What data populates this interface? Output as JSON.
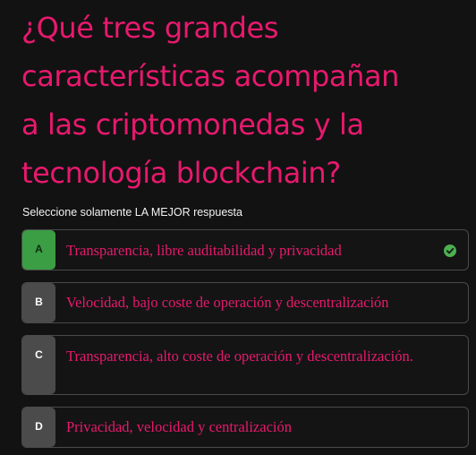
{
  "question": {
    "lines": [
      "¿Qué tres grandes",
      "características acompañan",
      "a las criptomonedas y la",
      "tecnología blockchain?"
    ]
  },
  "instruction": "Seleccione solamente LA MEJOR respuesta",
  "answers": [
    {
      "letter": "A",
      "text": "Transparencia, libre auditabilidad y privacidad",
      "selected": true,
      "status_icon": "check-circle-icon"
    },
    {
      "letter": "B",
      "text": "Velocidad, bajo coste de operación y descentralización",
      "selected": false
    },
    {
      "letter": "C",
      "text": "Transparencia, alto coste de operación y descentralización.",
      "selected": false
    },
    {
      "letter": "D",
      "text": "Privacidad, velocidad y centralización",
      "selected": false
    }
  ],
  "colors": {
    "accent": "#e8196e",
    "background": "#121212",
    "selected_letter_bg": "#3b9e45",
    "letter_bg": "#4b4b4b",
    "check": "#4caf50"
  }
}
